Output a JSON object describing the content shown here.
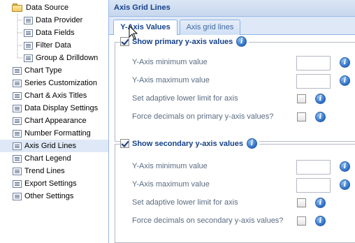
{
  "tree": {
    "root": {
      "label": "Data Source",
      "icon": "folder-icon"
    },
    "children": [
      {
        "label": "Data Provider",
        "icon": "page-icon"
      },
      {
        "label": "Data Fields",
        "icon": "page-icon"
      },
      {
        "label": "Filter Data",
        "icon": "page-icon"
      },
      {
        "label": "Group & Drilldown",
        "icon": "page-icon"
      }
    ],
    "items": [
      {
        "label": "Chart Type",
        "icon": "page-icon"
      },
      {
        "label": "Series Customization",
        "icon": "page-icon"
      },
      {
        "label": "Chart & Axis Titles",
        "icon": "page-icon"
      },
      {
        "label": "Data Display Settings",
        "icon": "page-icon"
      },
      {
        "label": "Chart Appearance",
        "icon": "page-icon"
      },
      {
        "label": "Number Formatting",
        "icon": "page-icon"
      },
      {
        "label": "Axis Grid Lines",
        "icon": "page-icon",
        "selected": true
      },
      {
        "label": "Chart Legend",
        "icon": "page-icon"
      },
      {
        "label": "Trend Lines",
        "icon": "page-icon"
      },
      {
        "label": "Export Settings",
        "icon": "page-icon"
      },
      {
        "label": "Other Settings",
        "icon": "page-icon"
      }
    ]
  },
  "panel": {
    "title": "Axis Grid Lines",
    "tabs": [
      {
        "label": "Y-Axis Values",
        "active": true
      },
      {
        "label": "Axis grid lines",
        "active": false
      }
    ],
    "primary": {
      "title": "Show primary y-axis values",
      "checked": true,
      "min_label": "Y-Axis minimum value",
      "min_value": "",
      "max_label": "Y-Axis maximum value",
      "max_value": "",
      "adaptive_label": "Set adaptive lower limit for axis",
      "adaptive_checked": false,
      "decimals_label": "Force decimals on primary y-axis values?",
      "decimals_checked": false
    },
    "secondary": {
      "title": "Show secondary y-axis values",
      "checked": true,
      "min_label": "Y-Axis minimum value",
      "min_value": "",
      "max_label": "Y-Axis maximum value",
      "max_value": "",
      "adaptive_label": "Set adaptive lower limit for axis",
      "adaptive_checked": false,
      "decimals_label": "Force decimals on secondary y-axis values?",
      "decimals_checked": false
    },
    "info_glyph": "i"
  },
  "colors": {
    "selected_row": "#dfe8f6",
    "header_text": "#15428b",
    "label_text": "#5a6b82",
    "info_blue": "#2b6fc7"
  }
}
